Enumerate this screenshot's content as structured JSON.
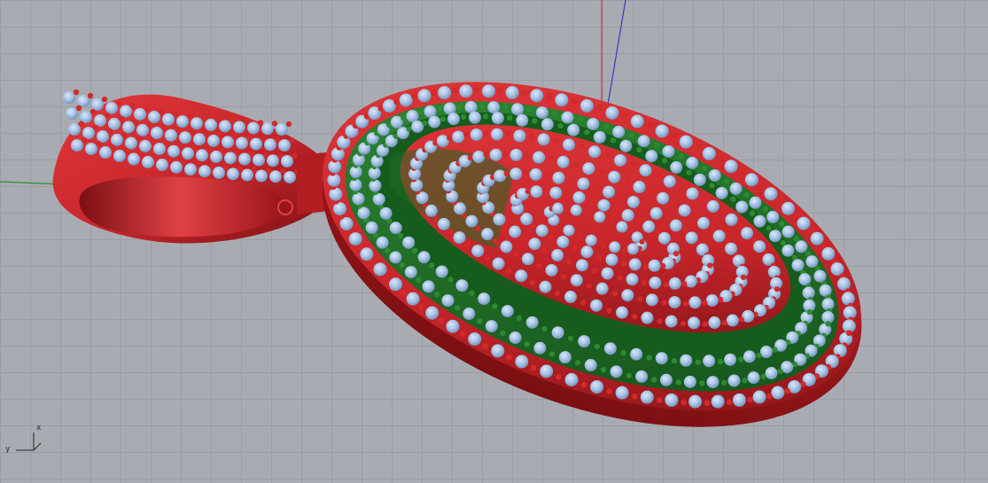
{
  "viewport": {
    "name": "Perspective",
    "world_axes": {
      "x_color": "#2f8f2f",
      "y_color": "#c23a3a",
      "z_color": "#3a3ab8"
    },
    "colors": {
      "grid_background": "#a8acb2",
      "metal_red": "#c8262b",
      "metal_red_dark": "#8f1518",
      "metal_green": "#1f6e24",
      "metal_green_dark": "#0f4513",
      "stone_blue": "#a8c4e6",
      "stone_blue_dark": "#6f8fb8",
      "prong_red": "#d22a2a",
      "prong_green": "#2e8a32"
    },
    "object": "pendant",
    "parts": [
      "bail",
      "oval-frame",
      "inner-green-band",
      "inner-red-field"
    ]
  },
  "triad": {
    "x_label": "x",
    "y_label": "y"
  }
}
